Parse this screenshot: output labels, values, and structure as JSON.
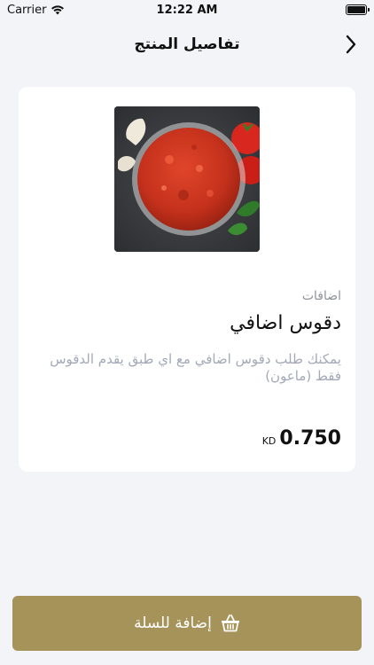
{
  "status_bar": {
    "carrier": "Carrier",
    "time": "12:22 AM"
  },
  "nav": {
    "title": "تفاصيل المنتج"
  },
  "product": {
    "section_label": "اضافات",
    "name": "دقوس اضافي",
    "description": "يمكنك طلب دقوس اضافي مع اي طبق يقدم الدقوس فقط (ماعون)",
    "price": "0.750",
    "currency": "KD"
  },
  "cart_button": {
    "label": "إضافة للسلة"
  }
}
